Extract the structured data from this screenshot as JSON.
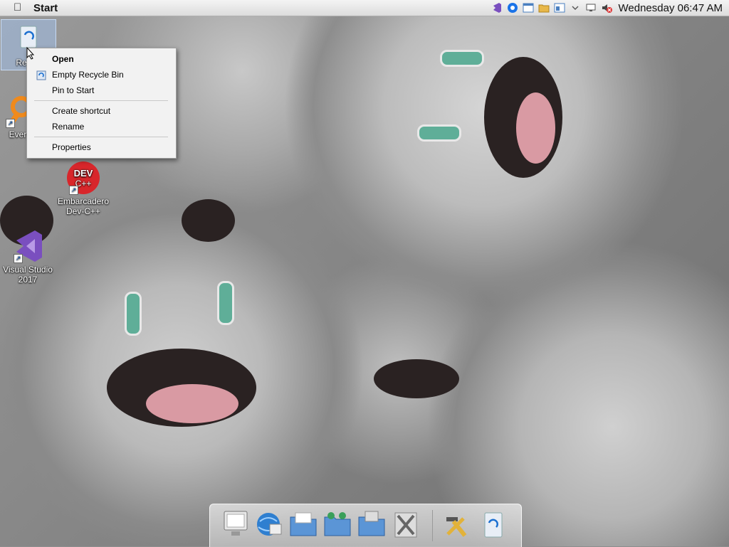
{
  "menubar": {
    "start_label": "Start",
    "clock": "Wednesday 06:47 AM",
    "tray_icons": [
      "visual-studio-icon",
      "chrome-icon",
      "window-icon",
      "folder-icon",
      "window-icon",
      "chevron-down-icon",
      "network-icon",
      "speaker-muted-icon"
    ]
  },
  "desktop": {
    "icons": [
      {
        "name": "recycle-bin",
        "label": "Recyc"
      },
      {
        "name": "everything",
        "label": "Every"
      },
      {
        "name": "dev-cpp",
        "label": "Embarcadero Dev-C++",
        "badge": "DEV C++"
      },
      {
        "name": "visual-studio",
        "label": "Visual Studio 2017"
      }
    ]
  },
  "context_menu": {
    "items": [
      {
        "label": "Open",
        "bold": true
      },
      {
        "label": "Empty Recycle Bin",
        "icon": "recycle-shield-icon"
      },
      {
        "label": "Pin to Start"
      },
      {
        "label": "Create shortcut"
      },
      {
        "label": "Rename"
      },
      {
        "label": "Properties"
      }
    ]
  },
  "dock": {
    "items": [
      "monitor-icon",
      "globe-icon",
      "folder-documents-icon",
      "folder-network-icon",
      "folder-drive-icon",
      "tools-icon",
      "hammer-wrench-icon",
      "recycle-bin-icon"
    ]
  },
  "colors": {
    "accent": "#1a5fb4",
    "dev_cpp_red": "#d8262b",
    "vs_purple": "#7a4fbf"
  }
}
